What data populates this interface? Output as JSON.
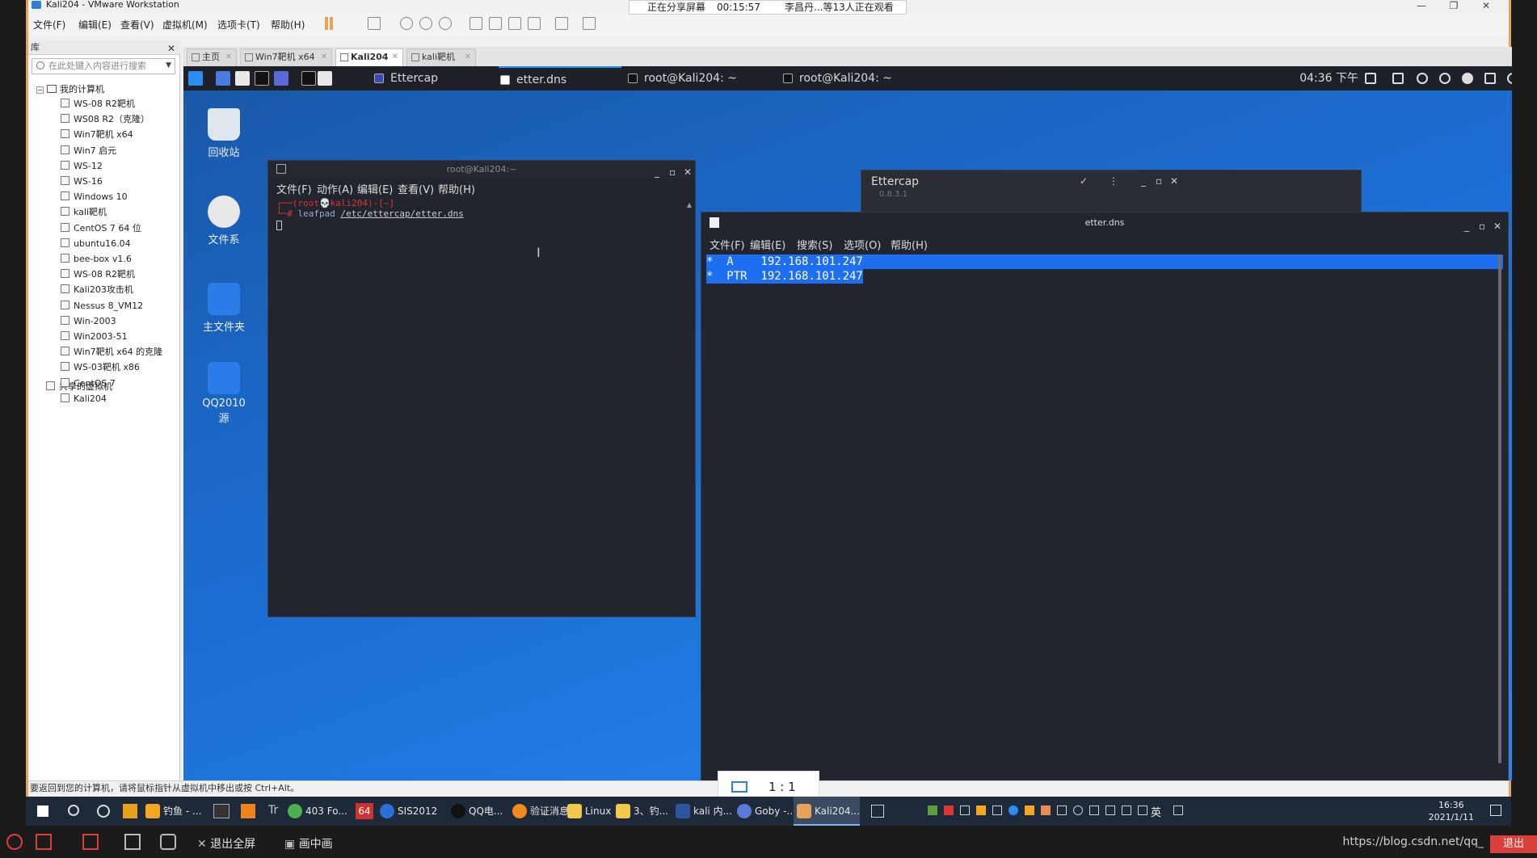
{
  "vmware": {
    "title": "Kali204 - VMware Workstation",
    "menu": [
      "文件(F)",
      "编辑(E)",
      "查看(V)",
      "虚拟机(M)",
      "选项卡(T)",
      "帮助(H)"
    ]
  },
  "share_banner": {
    "status": "正在分享屏幕",
    "time": "00:15:57",
    "viewers": "李昌丹...等13人正在观看"
  },
  "library": {
    "title": "库",
    "search_placeholder": "在此处键入内容进行搜索",
    "root": "我的计算机",
    "items": [
      "WS-08 R2靶机",
      "WS08 R2（克隆）",
      "Win7靶机 x64",
      "Win7 启元",
      "WS-12",
      "WS-16",
      "Windows 10",
      "kali靶机",
      "CentOS 7 64 位",
      "ubuntu16.04",
      "bee-box v1.6",
      "WS-08 R2靶机",
      "Kali203攻击机",
      "Nessus 8_VM12",
      "Win-2003",
      "Win2003-51",
      "Win7靶机 x64 的克隆",
      "WS-03靶机 x86",
      "CentOS 7",
      "Kali204"
    ],
    "shared": "共享的虚拟机"
  },
  "vm_tabs": [
    {
      "label": "主页",
      "active": false
    },
    {
      "label": "Win7靶机 x64",
      "active": false
    },
    {
      "label": "Kali204",
      "active": true
    },
    {
      "label": "kali靶机",
      "active": false
    }
  ],
  "kali_panel": {
    "tasks": [
      {
        "label": "Ettercap",
        "active": false
      },
      {
        "label": "etter.dns",
        "active": true
      },
      {
        "label": "root@Kali204: ~",
        "active": false
      },
      {
        "label": "root@Kali204: ~",
        "active": false
      }
    ],
    "clock": "04:36 下午"
  },
  "desktop_icons": [
    "回收站",
    "文件系",
    "主文件夹",
    "QQ2010 源"
  ],
  "terminal": {
    "title": "root@Kali204:~",
    "menu": [
      "文件(F)",
      "动作(A)",
      "编辑(E)",
      "查看(V)",
      "帮助(H)"
    ],
    "prompt": "┌──(root💀kali204)-[~]",
    "prompt_symbol": "└─#",
    "command": "leafpad",
    "command_arg": "/etc/ettercap/etter.dns"
  },
  "ettercap": {
    "title": "Ettercap",
    "version": "0.8.3.1"
  },
  "leafpad": {
    "title": "etter.dns",
    "menu": [
      "文件(F)",
      "编辑(E)",
      "搜索(S)",
      "选项(O)",
      "帮助(H)"
    ],
    "lines": [
      "*  A    192.168.101.247",
      "*  PTR  192.168.101.247"
    ]
  },
  "zoom": {
    "label": "1 : 1"
  },
  "vm_status": "要返回到您的计算机，请将鼠标指针从虚拟机中移出或按 Ctrl+Alt。",
  "win_taskbar": {
    "items": [
      "钓鱼 - ...",
      "403 Fo...",
      "SIS2012",
      "QQ电...",
      "验证消息",
      "Linux",
      "3、钓...",
      "kali 内...",
      "Goby -...",
      "Kali204..."
    ],
    "ime": "英",
    "time": "16:36",
    "date": "2021/1/11"
  },
  "meeting_bar": {
    "exit_fullscreen": "退出全屏",
    "pip": "画中画",
    "watermark": "https://blog.csdn.net/qq_",
    "exit": "退出"
  },
  "colors": {
    "accent": "#e8a35a",
    "selection": "#1e6ff0",
    "kali_desktop": "#1c6fd6",
    "terminal_bg": "#23252e",
    "exit_red": "#d9403a"
  }
}
